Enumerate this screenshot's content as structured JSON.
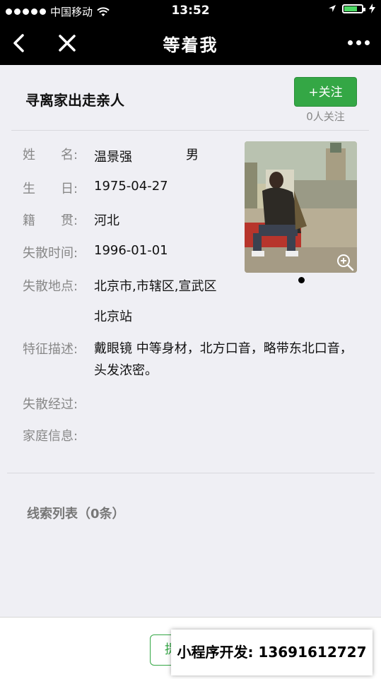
{
  "status_bar": {
    "carrier": "中国移动",
    "time": "13:52",
    "battery_color": "#4cd964"
  },
  "nav": {
    "title": "等着我",
    "back_icon": "chevron-left-icon",
    "close_icon": "close-icon",
    "more_icon": "more-dots-icon"
  },
  "header": {
    "title": "寻离家出走亲人",
    "follow_label": "+关注",
    "follow_count": "0人关注",
    "accent": "#34a745"
  },
  "person": {
    "name_label": "姓　　名:",
    "name": "温景强",
    "gender": "男",
    "birthday_label": "生　　日:",
    "birthday": "1975-04-27",
    "native_label": "籍　　贯:",
    "native_place": "河北",
    "lost_time_label": "失散时间:",
    "lost_time": "1996-01-01",
    "lost_place_label": "失散地点:",
    "lost_place": "北京市,市辖区,宣武区",
    "lost_place_detail": "北京站",
    "features_label": "特征描述:",
    "features": "戴眼镜 中等身材，北方口音，略带东北口音，头发浓密。",
    "process_label": "失散经过:",
    "process": "",
    "family_label": "家庭信息:",
    "family": ""
  },
  "photo": {
    "zoom_icon": "zoom-in-icon",
    "page_indicator": "1 of 1"
  },
  "clues": {
    "label": "线索列表（0条）"
  },
  "bottom": {
    "button_label": "提",
    "promo_text": "小程序开发: 13691612727"
  }
}
